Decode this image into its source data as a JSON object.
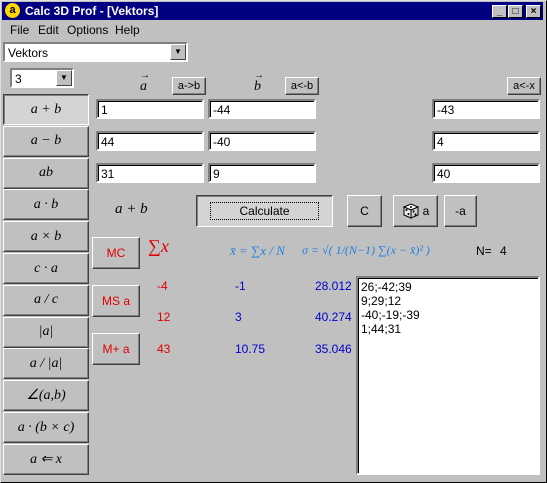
{
  "window": {
    "title": "Calc 3D Prof - [Vektors]",
    "icon_letter": "a",
    "controls": {
      "minimize": "_",
      "maximize": "□",
      "close": "×"
    }
  },
  "menu": [
    "File",
    "Edit",
    "Options",
    "Help"
  ],
  "module_select": {
    "value": "Vektors"
  },
  "dimension_select": {
    "value": "3"
  },
  "headers": {
    "a": "a",
    "b": "b"
  },
  "copy_buttons": {
    "a_to_b": "a->b",
    "a_from_b": "a<-b",
    "a_from_x": "a<-x"
  },
  "operations": [
    {
      "label": "a + b",
      "name": "op-sum"
    },
    {
      "label": "a − b",
      "name": "op-difference"
    },
    {
      "label": "ab",
      "name": "op-dyadic-product"
    },
    {
      "label": "a · b",
      "name": "op-dot-product"
    },
    {
      "label": "a × b",
      "name": "op-cross-product"
    },
    {
      "label": "c · a",
      "name": "op-scalar-multiply"
    },
    {
      "label": "a / c",
      "name": "op-scalar-divide"
    },
    {
      "label": "|a|",
      "name": "op-magnitude"
    },
    {
      "label": "a / |a|",
      "name": "op-unit-vector"
    },
    {
      "label": "∠(a,b)",
      "name": "op-angle"
    },
    {
      "label": "a · (b × c)",
      "name": "op-triple-product"
    },
    {
      "label": "a ⇐ x",
      "name": "op-assign-x"
    }
  ],
  "vector_a": [
    "1",
    "44",
    "31"
  ],
  "vector_b": [
    "-44",
    "-40",
    "9"
  ],
  "vector_x": [
    "-43",
    "4",
    "40"
  ],
  "current_operation": "a + b",
  "buttons": {
    "calculate": "Calculate",
    "clear": "C",
    "random": "a",
    "negate": "-a"
  },
  "memory_buttons": {
    "mc": "MC",
    "ms": "MS a",
    "mplus": "M+ a"
  },
  "stats": {
    "sum_label": "∑x",
    "mean_label": "x̄ = ∑x / N",
    "sigma_label": "σ = √( 1/(N−1) ∑(x − x̄)² )",
    "n_label": "N=",
    "n_value": "4",
    "rows": [
      {
        "sum": "-4",
        "mean": "-1",
        "sigma": "28.012"
      },
      {
        "sum": "12",
        "mean": "3",
        "sigma": "40.274"
      },
      {
        "sum": "43",
        "mean": "10.75",
        "sigma": "35.046"
      }
    ]
  },
  "memory_list": "26;-42;39\n9;29;12\n-40;-19;-39\n1;44;31",
  "colors": {
    "title_bar": "#000080",
    "memory_red": "#e00000",
    "stats_blue": "#0000d0",
    "formula_cyan": "#2080e0"
  }
}
